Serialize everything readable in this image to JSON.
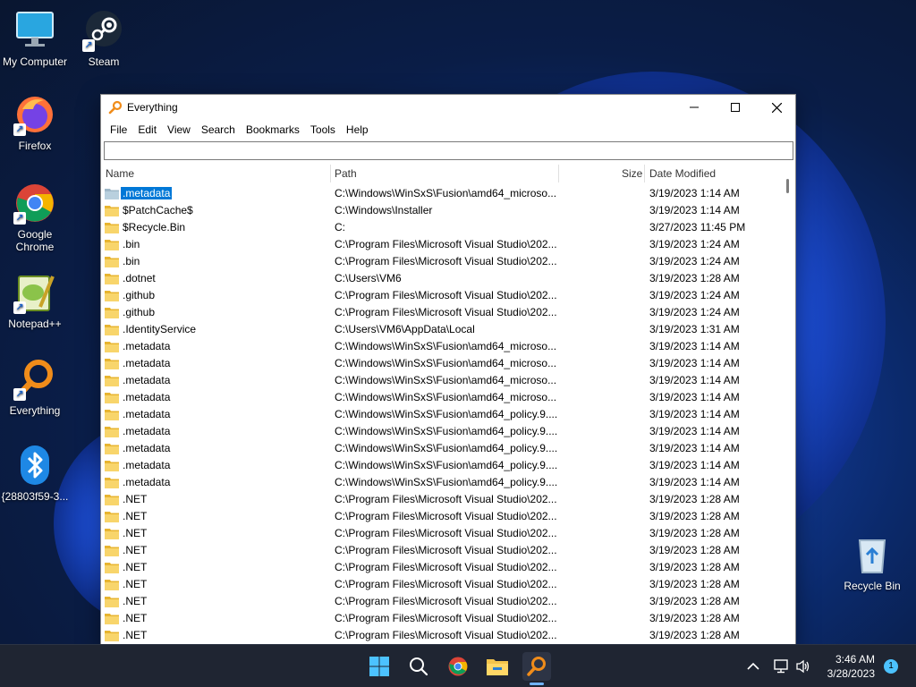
{
  "desktop": {
    "icons": [
      {
        "label": "My Computer"
      },
      {
        "label": "Steam"
      },
      {
        "label": "Firefox"
      },
      {
        "label": "Google Chrome"
      },
      {
        "label": "Notepad++"
      },
      {
        "label": "Everything"
      },
      {
        "label": "{28803f59-3..."
      },
      {
        "label": "Recycle Bin"
      }
    ]
  },
  "window": {
    "title": "Everything",
    "menu": [
      "File",
      "Edit",
      "View",
      "Search",
      "Bookmarks",
      "Tools",
      "Help"
    ],
    "search_value": "",
    "columns": {
      "name": "Name",
      "path": "Path",
      "size": "Size",
      "date": "Date Modified"
    },
    "rows": [
      {
        "name": ".metadata",
        "path": "C:\\Windows\\WinSxS\\Fusion\\amd64_microso...",
        "date": "3/19/2023 1:14 AM",
        "selected": true
      },
      {
        "name": "$PatchCache$",
        "path": "C:\\Windows\\Installer",
        "date": "3/19/2023 1:14 AM"
      },
      {
        "name": "$Recycle.Bin",
        "path": "C:",
        "date": "3/27/2023 11:45 PM"
      },
      {
        "name": ".bin",
        "path": "C:\\Program Files\\Microsoft Visual Studio\\202...",
        "date": "3/19/2023 1:24 AM"
      },
      {
        "name": ".bin",
        "path": "C:\\Program Files\\Microsoft Visual Studio\\202...",
        "date": "3/19/2023 1:24 AM"
      },
      {
        "name": ".dotnet",
        "path": "C:\\Users\\VM6",
        "date": "3/19/2023 1:28 AM"
      },
      {
        "name": ".github",
        "path": "C:\\Program Files\\Microsoft Visual Studio\\202...",
        "date": "3/19/2023 1:24 AM"
      },
      {
        "name": ".github",
        "path": "C:\\Program Files\\Microsoft Visual Studio\\202...",
        "date": "3/19/2023 1:24 AM"
      },
      {
        "name": ".IdentityService",
        "path": "C:\\Users\\VM6\\AppData\\Local",
        "date": "3/19/2023 1:31 AM"
      },
      {
        "name": ".metadata",
        "path": "C:\\Windows\\WinSxS\\Fusion\\amd64_microso...",
        "date": "3/19/2023 1:14 AM"
      },
      {
        "name": ".metadata",
        "path": "C:\\Windows\\WinSxS\\Fusion\\amd64_microso...",
        "date": "3/19/2023 1:14 AM"
      },
      {
        "name": ".metadata",
        "path": "C:\\Windows\\WinSxS\\Fusion\\amd64_microso...",
        "date": "3/19/2023 1:14 AM"
      },
      {
        "name": ".metadata",
        "path": "C:\\Windows\\WinSxS\\Fusion\\amd64_microso...",
        "date": "3/19/2023 1:14 AM"
      },
      {
        "name": ".metadata",
        "path": "C:\\Windows\\WinSxS\\Fusion\\amd64_policy.9....",
        "date": "3/19/2023 1:14 AM"
      },
      {
        "name": ".metadata",
        "path": "C:\\Windows\\WinSxS\\Fusion\\amd64_policy.9....",
        "date": "3/19/2023 1:14 AM"
      },
      {
        "name": ".metadata",
        "path": "C:\\Windows\\WinSxS\\Fusion\\amd64_policy.9....",
        "date": "3/19/2023 1:14 AM"
      },
      {
        "name": ".metadata",
        "path": "C:\\Windows\\WinSxS\\Fusion\\amd64_policy.9....",
        "date": "3/19/2023 1:14 AM"
      },
      {
        "name": ".metadata",
        "path": "C:\\Windows\\WinSxS\\Fusion\\amd64_policy.9....",
        "date": "3/19/2023 1:14 AM"
      },
      {
        "name": ".NET",
        "path": "C:\\Program Files\\Microsoft Visual Studio\\202...",
        "date": "3/19/2023 1:28 AM"
      },
      {
        "name": ".NET",
        "path": "C:\\Program Files\\Microsoft Visual Studio\\202...",
        "date": "3/19/2023 1:28 AM"
      },
      {
        "name": ".NET",
        "path": "C:\\Program Files\\Microsoft Visual Studio\\202...",
        "date": "3/19/2023 1:28 AM"
      },
      {
        "name": ".NET",
        "path": "C:\\Program Files\\Microsoft Visual Studio\\202...",
        "date": "3/19/2023 1:28 AM"
      },
      {
        "name": ".NET",
        "path": "C:\\Program Files\\Microsoft Visual Studio\\202...",
        "date": "3/19/2023 1:28 AM"
      },
      {
        "name": ".NET",
        "path": "C:\\Program Files\\Microsoft Visual Studio\\202...",
        "date": "3/19/2023 1:28 AM"
      },
      {
        "name": ".NET",
        "path": "C:\\Program Files\\Microsoft Visual Studio\\202...",
        "date": "3/19/2023 1:28 AM"
      },
      {
        "name": ".NET",
        "path": "C:\\Program Files\\Microsoft Visual Studio\\202...",
        "date": "3/19/2023 1:28 AM"
      },
      {
        "name": ".NET",
        "path": "C:\\Program Files\\Microsoft Visual Studio\\202...",
        "date": "3/19/2023 1:28 AM"
      }
    ]
  },
  "taskbar": {
    "time": "3:46 AM",
    "date": "3/28/2023",
    "notification_count": "1"
  },
  "colors": {
    "selection": "#0078d7",
    "folder": "#f3c44b",
    "accent": "#0078d7"
  }
}
